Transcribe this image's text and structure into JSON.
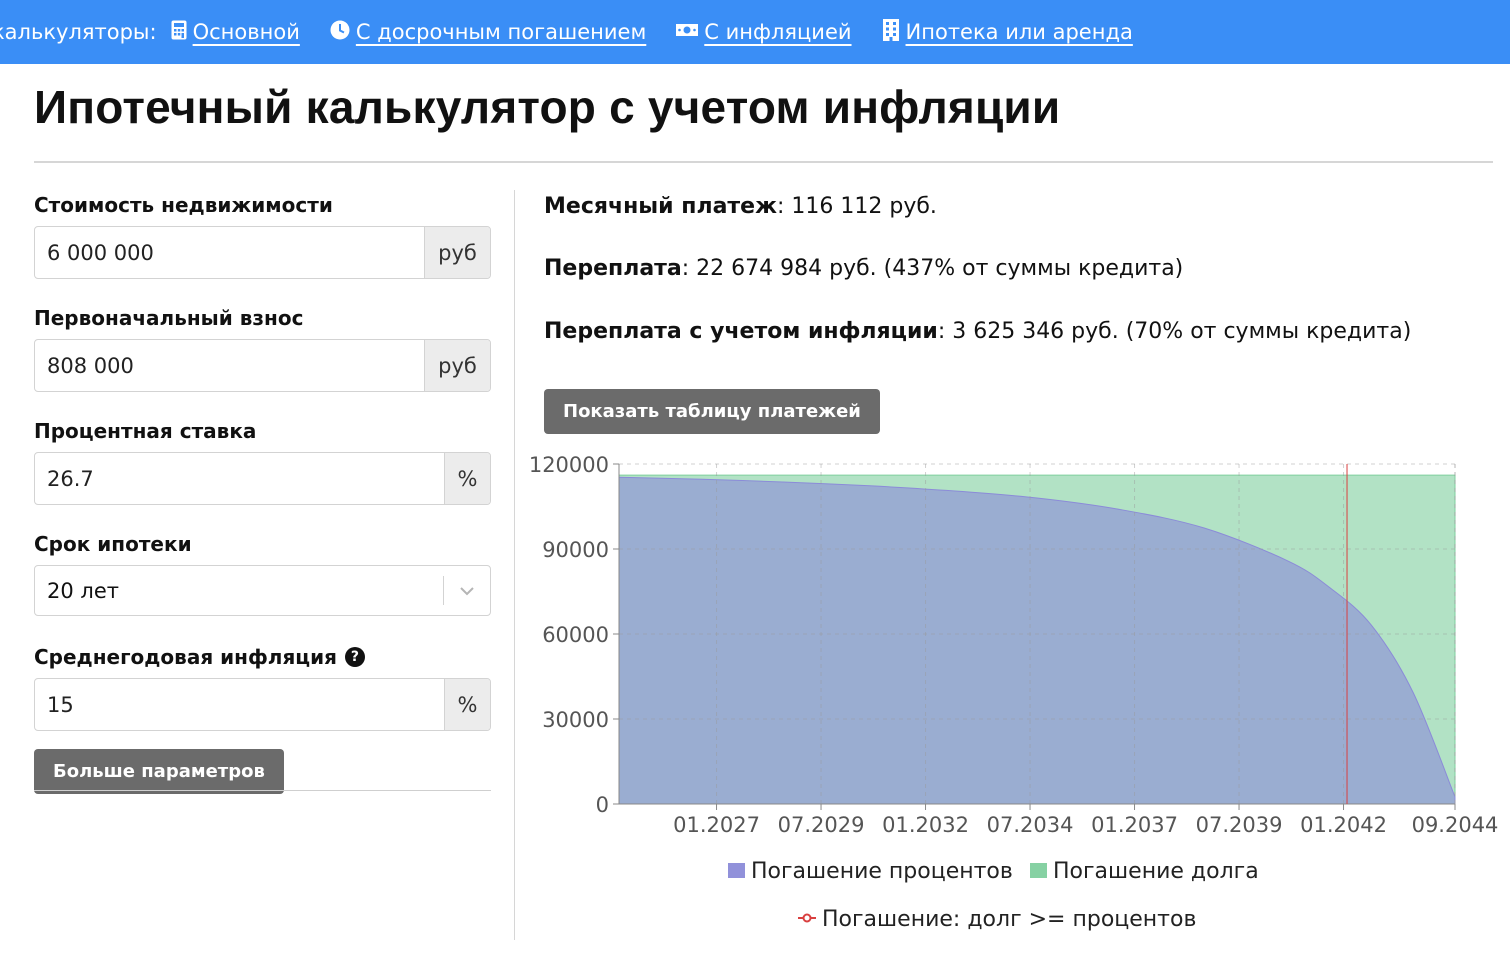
{
  "nav": {
    "lead": "калькуляторы:",
    "links": [
      {
        "label": "Основной",
        "icon": "calculator-icon"
      },
      {
        "label": "С досрочным погашением",
        "icon": "clock-icon"
      },
      {
        "label": "С инфляцией",
        "icon": "money-icon"
      },
      {
        "label": "Ипотека или аренда",
        "icon": "building-icon"
      }
    ]
  },
  "page_title": "Ипотечный калькулятор с учетом инфляции",
  "form": {
    "price": {
      "label": "Стоимость недвижимости",
      "value": "6 000 000",
      "unit": "руб"
    },
    "down": {
      "label": "Первоначальный взнос",
      "value": "808 000",
      "unit": "руб"
    },
    "rate": {
      "label": "Процентная ставка",
      "value": "26.7",
      "unit": "%"
    },
    "term": {
      "label": "Срок ипотеки",
      "value": "20 лет"
    },
    "inflation": {
      "label": "Среднегодовая инфляция",
      "value": "15",
      "unit": "%"
    },
    "more_button": "Больше параметров"
  },
  "results": {
    "monthly_label": "Месячный платеж",
    "monthly_value": ": 116 112 руб.",
    "overpay_label": "Переплата",
    "overpay_value": ": 22 674 984 руб. (437% от суммы кредита)",
    "overpay_infl_label": "Переплата с учетом инфляции",
    "overpay_infl_value": ": 3 625 346 руб. (70% от суммы кредита)",
    "table_button": "Показать таблицу платежей"
  },
  "colors": {
    "nav_bg": "#3a8ef6",
    "interest": "#b5b5e6",
    "principal": "#b2dfc2",
    "marker": "#d94040",
    "button": "#6b6b6b"
  },
  "chart_data": {
    "type": "area",
    "stacked": true,
    "x_ticks": [
      "01.2027",
      "07.2029",
      "01.2032",
      "07.2034",
      "01.2037",
      "07.2039",
      "01.2042",
      "09.2044"
    ],
    "y_ticks": [
      "0",
      "30000",
      "60000",
      "90000",
      "120000"
    ],
    "ylim": [
      0,
      120000
    ],
    "x_range": [
      "09.2024",
      "09.2044"
    ],
    "series": [
      {
        "name": "Погашение процентов",
        "color": "#8b8bd8",
        "x": [
          "09.2024",
          "09.2026",
          "09.2028",
          "09.2030",
          "09.2032",
          "09.2034",
          "09.2036",
          "09.2038",
          "09.2040",
          "09.2041",
          "09.2042",
          "09.2043",
          "09.2044"
        ],
        "values": [
          115300,
          114600,
          113600,
          112300,
          110500,
          108000,
          103900,
          97400,
          85800,
          76400,
          63100,
          39300,
          2500
        ]
      },
      {
        "name": "Погашение долга",
        "color": "#7fcf9e",
        "x": [
          "09.2024",
          "09.2026",
          "09.2028",
          "09.2030",
          "09.2032",
          "09.2034",
          "09.2036",
          "09.2038",
          "09.2040",
          "09.2041",
          "09.2042",
          "09.2043",
          "09.2044"
        ],
        "values": [
          800,
          1500,
          2500,
          3800,
          5600,
          8100,
          12200,
          18700,
          30300,
          39700,
          53000,
          76800,
          113600
        ]
      }
    ],
    "total": 116112,
    "marker": {
      "x": "02.2042",
      "label": "Погашение: долг >= процентов"
    },
    "legend_position": "bottom",
    "grid": true
  }
}
